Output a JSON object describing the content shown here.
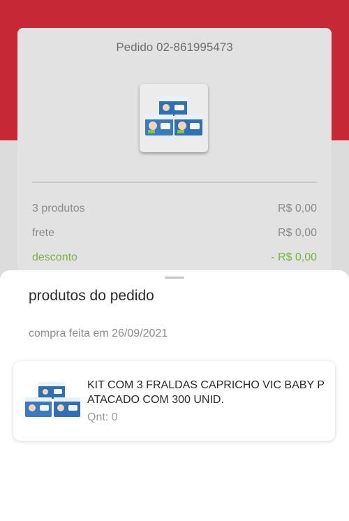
{
  "order": {
    "title": "Pedido 02-861995473",
    "product_image_icon": "diaper-package-icon",
    "summary": [
      {
        "label": "3 produtos",
        "value": "R$ 0,00"
      },
      {
        "label": "frete",
        "value": "R$ 0,00"
      },
      {
        "label": "desconto",
        "value": "- R$ 0,00"
      }
    ]
  },
  "sheet": {
    "title": "produtos do pedido",
    "purchase_date": "compra feita em 26/09/2021",
    "items": [
      {
        "name": "KIT COM 3 FRALDAS CAPRICHO VIC BABY P ATACADO COM 300 UNID.",
        "qty": "Qnt: 0"
      }
    ]
  },
  "colors": {
    "brand_red": "#c72836",
    "discount_green": "#7cb342",
    "package_blue": "#2f6fb3"
  }
}
